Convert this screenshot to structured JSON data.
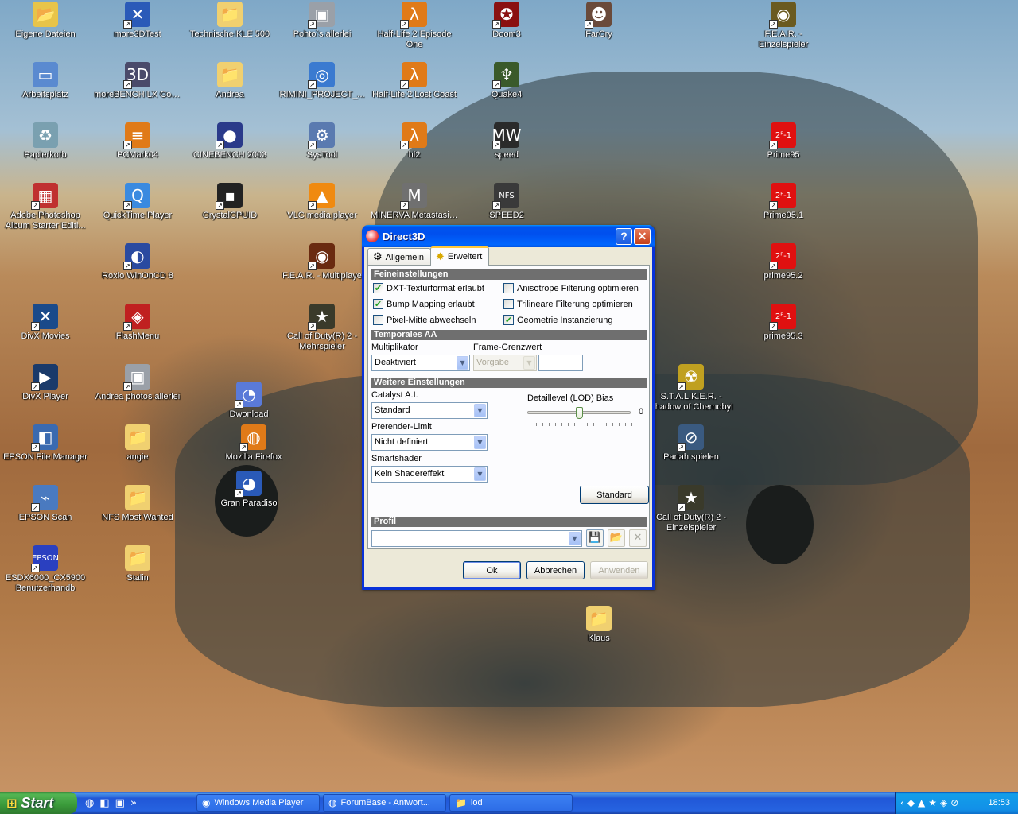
{
  "desktop": {
    "icons": [
      {
        "label": "Eigene Dateien",
        "glyph": "📂",
        "bg": "#e8c44a",
        "shortcut": false
      },
      {
        "label": "more3DTest",
        "glyph": "✕",
        "bg": "#2a5ab8",
        "shortcut": true
      },
      {
        "label": "Technische KLE 500",
        "glyph": "📁",
        "bg": "#f0d070",
        "shortcut": false
      },
      {
        "label": "Pohto´s allerlei",
        "glyph": "▣",
        "bg": "#9aa0a8",
        "shortcut": true
      },
      {
        "label": "Half-Life 2 Episode One",
        "glyph": "λ",
        "bg": "#e07a18",
        "shortcut": true
      },
      {
        "label": "Doom3",
        "glyph": "✪",
        "bg": "#8a1010",
        "shortcut": true
      },
      {
        "label": "FarCry",
        "glyph": "☻",
        "bg": "#6a4a3a",
        "shortcut": true
      },
      {
        "label": "F.E.A.R. - Einzelspieler",
        "glyph": "◉",
        "bg": "#6a5a20",
        "shortcut": true
      },
      {
        "label": "Arbeitsplatz",
        "glyph": "▭",
        "bg": "#5a8ad0",
        "shortcut": false
      },
      {
        "label": "moreBENCH LX Control",
        "glyph": "3D",
        "bg": "#4a4a6a",
        "shortcut": true
      },
      {
        "label": "Andrea",
        "glyph": "📁",
        "bg": "#f0d070",
        "shortcut": false
      },
      {
        "label": "RIMINI_PROJECT_...",
        "glyph": "◎",
        "bg": "#3a7ad0",
        "shortcut": true
      },
      {
        "label": "Half-Life 2 Lost Coast",
        "glyph": "λ",
        "bg": "#e07a18",
        "shortcut": true
      },
      {
        "label": "Quake4",
        "glyph": "♆",
        "bg": "#3a5a2a",
        "shortcut": true
      },
      {
        "label": "Papierkorb",
        "glyph": "♻",
        "bg": "#7aa0b0",
        "shortcut": false
      },
      {
        "label": "PCMark04",
        "glyph": "≡",
        "bg": "#e07a18",
        "shortcut": true
      },
      {
        "label": "CINEBENCH 2003",
        "glyph": "●",
        "bg": "#2a3a8a",
        "shortcut": true
      },
      {
        "label": "SysTool",
        "glyph": "⚙",
        "bg": "#5a7ab0",
        "shortcut": true
      },
      {
        "label": "hl2",
        "glyph": "λ",
        "bg": "#e07a18",
        "shortcut": true
      },
      {
        "label": "speed",
        "glyph": "MW",
        "bg": "#2a2a2a",
        "shortcut": true
      },
      {
        "label": "Prime95",
        "glyph": "2ᴾ-1",
        "bg": "#e01010",
        "shortcut": true
      },
      {
        "label": "Adobe Photoshop Album Starter Editi...",
        "glyph": "▦",
        "bg": "#c03030",
        "shortcut": true
      },
      {
        "label": "QuickTime Player",
        "glyph": "Q",
        "bg": "#3a8ae0",
        "shortcut": true
      },
      {
        "label": "CrystalCPUID",
        "glyph": "▪",
        "bg": "#222222",
        "shortcut": true
      },
      {
        "label": "VLC media player",
        "glyph": "▲",
        "bg": "#f08a10",
        "shortcut": true
      },
      {
        "label": "MINERVA Metastasis 2",
        "glyph": "M",
        "bg": "#707070",
        "shortcut": true
      },
      {
        "label": "SPEED2",
        "glyph": "NFS",
        "bg": "#3a3a3a",
        "shortcut": true
      },
      {
        "label": "Prime95.1",
        "glyph": "2ᴾ-1",
        "bg": "#e01010",
        "shortcut": true
      },
      {
        "label": "Roxio WinOnCD 8",
        "glyph": "◐",
        "bg": "#2a4aa0",
        "shortcut": true
      },
      {
        "label": "F.E.A.R. - Multiplaye",
        "glyph": "◉",
        "bg": "#6a2a10",
        "shortcut": true
      },
      {
        "label": "prime95.2",
        "glyph": "2ᴾ-1",
        "bg": "#e01010",
        "shortcut": true
      },
      {
        "label": "DivX Movies",
        "glyph": "✕",
        "bg": "#1a4a8a",
        "shortcut": true
      },
      {
        "label": "FlashMenu",
        "glyph": "◈",
        "bg": "#c02020",
        "shortcut": true
      },
      {
        "label": "Call of Duty(R) 2 - Mehrspieler",
        "glyph": "★",
        "bg": "#3a3a2a",
        "shortcut": true
      },
      {
        "label": "prime95.3",
        "glyph": "2ᴾ-1",
        "bg": "#e01010",
        "shortcut": true
      },
      {
        "label": "DivX Player",
        "glyph": "▶",
        "bg": "#1a3a6a",
        "shortcut": true
      },
      {
        "label": "Andrea photos allerlei",
        "glyph": "▣",
        "bg": "#9aa0a8",
        "shortcut": true
      },
      {
        "label": "Dwonload",
        "glyph": "◔",
        "bg": "#5a7ad8",
        "shortcut": true
      },
      {
        "label": "S.T.A.L.K.E.R. - Shadow of Chernobyl",
        "glyph": "☢",
        "bg": "#c0a020",
        "shortcut": true
      },
      {
        "label": "EPSON File Manager",
        "glyph": "◧",
        "bg": "#3a6ab0",
        "shortcut": true
      },
      {
        "label": "angie",
        "glyph": "📁",
        "bg": "#f0d070",
        "shortcut": false
      },
      {
        "label": "Mozilla Firefox",
        "glyph": "◍",
        "bg": "#e07a18",
        "shortcut": true
      },
      {
        "label": "Pariah spielen",
        "glyph": "⊘",
        "bg": "#3a5a80",
        "shortcut": true
      },
      {
        "label": "Gran Paradiso",
        "glyph": "◕",
        "bg": "#2a5ab8",
        "shortcut": true
      },
      {
        "label": "EPSON Scan",
        "glyph": "⌁",
        "bg": "#4a7ac0",
        "shortcut": true
      },
      {
        "label": "NFS Most Wanted",
        "glyph": "📁",
        "bg": "#f0d070",
        "shortcut": false
      },
      {
        "label": "Call of Duty(R) 2 - Einzelspieler",
        "glyph": "★",
        "bg": "#3a3a2a",
        "shortcut": true
      },
      {
        "label": "ESDX6000_CX5900 Benutzerhandb",
        "glyph": "EPSON",
        "bg": "#2a40c0",
        "shortcut": true
      },
      {
        "label": "Stalin",
        "glyph": "📁",
        "bg": "#f0d070",
        "shortcut": false
      },
      {
        "label": "Klaus",
        "glyph": "📁",
        "bg": "#f0d070",
        "shortcut": false
      }
    ]
  },
  "dialog": {
    "title": "Direct3D",
    "help_btn": "?",
    "close_btn": "✕",
    "tabs": [
      {
        "label": "Allgemein",
        "glyph": "⚙"
      },
      {
        "label": "Erweitert",
        "glyph": "✸"
      }
    ],
    "feineinstellungen": {
      "header": "Feineinstellungen",
      "options": [
        {
          "label": "DXT-Texturformat erlaubt",
          "checked": true
        },
        {
          "label": "Anisotrope Filterung optimieren",
          "checked": false
        },
        {
          "label": "Bump Mapping erlaubt",
          "checked": true
        },
        {
          "label": "Trilineare Filterung optimieren",
          "checked": false
        },
        {
          "label": "Pixel-Mitte abwechseln",
          "checked": false
        },
        {
          "label": "Geometrie Instanzierung",
          "checked": true
        }
      ]
    },
    "temporal_aa": {
      "header": "Temporales AA",
      "multiplikator_label": "Multiplikator",
      "multiplikator_value": "Deaktiviert",
      "frame_label": "Frame-Grenzwert",
      "frame_value": "Vorgabe",
      "frame_text": ""
    },
    "weitere": {
      "header": "Weitere Einstellungen",
      "catalyst_label": "Catalyst A.I.",
      "catalyst_value": "Standard",
      "prerender_label": "Prerender-Limit",
      "prerender_value": "Nicht definiert",
      "smartshader_label": "Smartshader",
      "smartshader_value": "Kein Shadereffekt",
      "lod_label": "Detaillevel (LOD) Bias",
      "lod_value": "0",
      "lod_level": 0.5,
      "standard_btn": "Standard"
    },
    "profil": {
      "header": "Profil",
      "value": "",
      "save_icon": "💾",
      "open_icon": "📂",
      "delete_icon": "✕"
    },
    "buttons": {
      "ok": "Ok",
      "cancel": "Abbrechen",
      "apply": "Anwenden"
    }
  },
  "taskbar": {
    "start_label": "Start",
    "start_glyph": "⊞",
    "quicklaunch": [
      "◍",
      "◧",
      "▣",
      "»"
    ],
    "tasks": [
      {
        "label": "Windows Media Player",
        "glyph": "◉"
      },
      {
        "label": "ForumBase - Antwort...",
        "glyph": "◍"
      },
      {
        "label": "lod",
        "glyph": "📁"
      }
    ],
    "tray_icons": [
      "‹",
      "◆",
      "▲",
      "★",
      "◈",
      "⊘"
    ],
    "clock": "18:53"
  }
}
